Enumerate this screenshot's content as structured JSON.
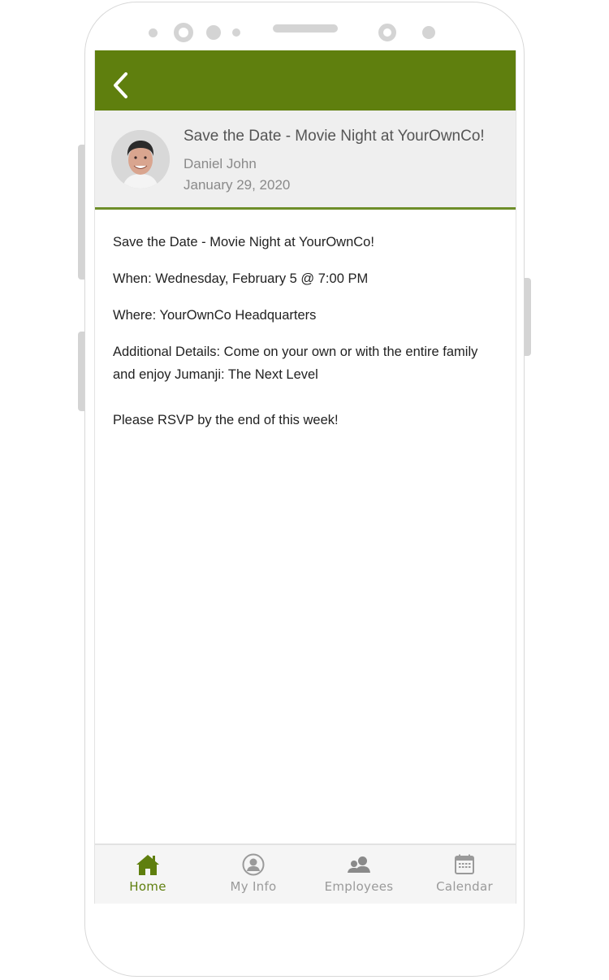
{
  "colors": {
    "brand_green": "#5f7f0e",
    "header_bg": "#efefef",
    "inactive_tab": "#9a9a9a"
  },
  "topbar": {
    "back_icon": "chevron-left-icon"
  },
  "post": {
    "title": "Save the Date - Movie Night at YourOwnCo!",
    "author": "Daniel John",
    "date": "January 29, 2020",
    "avatar": "author-photo"
  },
  "body": {
    "line1": "Save the Date - Movie Night at YourOwnCo!",
    "line2": "When: Wednesday, February 5 @ 7:00 PM",
    "line3": "Where: YourOwnCo Headquarters",
    "line4": "Additional Details: Come on your own or with the entire family and enjoy Jumanji: The Next Level",
    "line5": "Please RSVP by the end of this week!"
  },
  "tabbar": {
    "active": "Home",
    "tabs": [
      {
        "label": "Home",
        "icon": "home-icon"
      },
      {
        "label": "My Info",
        "icon": "user-circle-icon"
      },
      {
        "label": "Employees",
        "icon": "people-icon"
      },
      {
        "label": "Calendar",
        "icon": "calendar-icon"
      }
    ]
  }
}
